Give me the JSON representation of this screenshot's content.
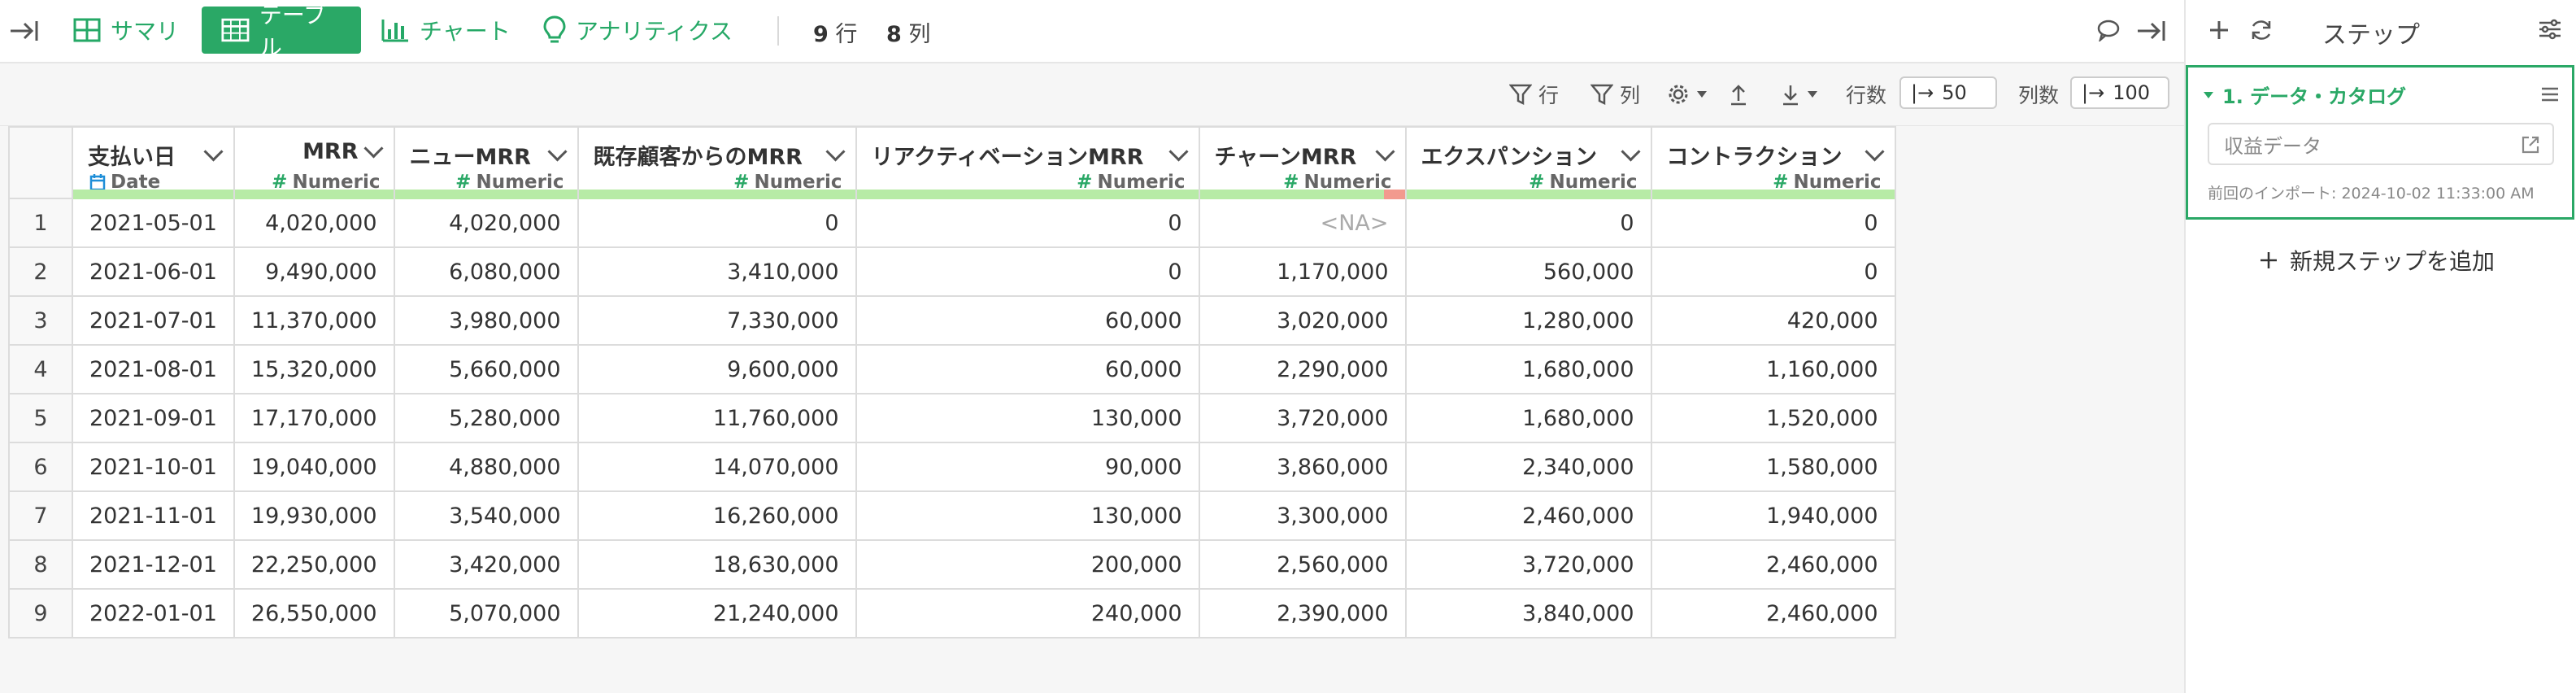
{
  "topbar": {
    "tabs": [
      {
        "label": "サマリ",
        "icon": "summary-grid-icon"
      },
      {
        "label": "テーブル",
        "icon": "table-icon"
      },
      {
        "label": "チャート",
        "icon": "bar-chart-icon"
      },
      {
        "label": "アナリティクス",
        "icon": "lightbulb-icon"
      }
    ],
    "rows_count": "9",
    "rows_label": "行",
    "cols_count": "8",
    "cols_label": "列"
  },
  "toolbar": {
    "filter_rows": "行",
    "filter_cols": "列",
    "rows_label": "行数",
    "rows_value": "50",
    "cols_label": "列数",
    "cols_value": "100"
  },
  "table": {
    "columns": [
      {
        "name": "支払い日",
        "type": "Date"
      },
      {
        "name": "MRR",
        "type": "Numeric"
      },
      {
        "name": "ニューMRR",
        "type": "Numeric"
      },
      {
        "name": "既存顧客からのMRR",
        "type": "Numeric"
      },
      {
        "name": "リアクティベーションMRR",
        "type": "Numeric"
      },
      {
        "name": "チャーンMRR",
        "type": "Numeric"
      },
      {
        "name": "エクスパンション",
        "type": "Numeric"
      },
      {
        "name": "コントラクション",
        "type": "Numeric"
      }
    ],
    "rows": [
      [
        "1",
        "2021-05-01",
        "4,020,000",
        "4,020,000",
        "0",
        "0",
        "<NA>",
        "0",
        "0"
      ],
      [
        "2",
        "2021-06-01",
        "9,490,000",
        "6,080,000",
        "3,410,000",
        "0",
        "1,170,000",
        "560,000",
        "0"
      ],
      [
        "3",
        "2021-07-01",
        "11,370,000",
        "3,980,000",
        "7,330,000",
        "60,000",
        "3,020,000",
        "1,280,000",
        "420,000"
      ],
      [
        "4",
        "2021-08-01",
        "15,320,000",
        "5,660,000",
        "9,600,000",
        "60,000",
        "2,290,000",
        "1,680,000",
        "1,160,000"
      ],
      [
        "5",
        "2021-09-01",
        "17,170,000",
        "5,280,000",
        "11,760,000",
        "130,000",
        "3,720,000",
        "1,680,000",
        "1,520,000"
      ],
      [
        "6",
        "2021-10-01",
        "19,040,000",
        "4,880,000",
        "14,070,000",
        "90,000",
        "3,860,000",
        "2,340,000",
        "1,580,000"
      ],
      [
        "7",
        "2021-11-01",
        "19,930,000",
        "3,540,000",
        "16,260,000",
        "130,000",
        "3,300,000",
        "2,460,000",
        "1,940,000"
      ],
      [
        "8",
        "2021-12-01",
        "22,250,000",
        "3,420,000",
        "18,630,000",
        "200,000",
        "2,560,000",
        "3,720,000",
        "2,460,000"
      ],
      [
        "9",
        "2022-01-01",
        "26,550,000",
        "5,070,000",
        "21,240,000",
        "240,000",
        "2,390,000",
        "3,840,000",
        "2,460,000"
      ]
    ]
  },
  "right_panel": {
    "title": "ステップ",
    "step": {
      "title": "1. データ・カタログ",
      "input_value": "収益データ",
      "meta": "前回のインポート: 2024-10-02 11:33:00 AM"
    },
    "add_step": "新規ステップを追加"
  },
  "colors": {
    "accent": "#2aa866",
    "quality_ok": "#b7eba6",
    "quality_bad": "#f29a8e"
  }
}
